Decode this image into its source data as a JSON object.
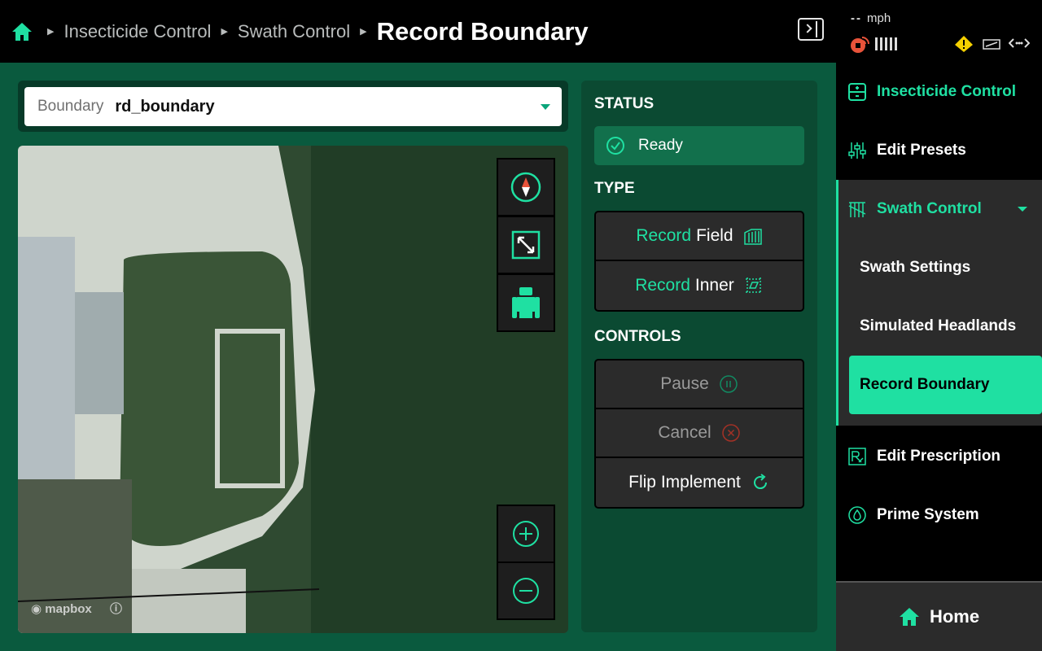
{
  "breadcrumb": {
    "items": [
      "Insecticide Control",
      "Swath Control"
    ],
    "current": "Record Boundary"
  },
  "status_bar": {
    "speed_value": "--",
    "speed_unit": "mph"
  },
  "boundary_select": {
    "label": "Boundary",
    "value": "rd_boundary"
  },
  "map": {
    "attribution": "mapbox"
  },
  "panel": {
    "status_title": "STATUS",
    "status_value": "Ready",
    "type_title": "TYPE",
    "record_field": {
      "prefix": "Record",
      "suffix": "Field"
    },
    "record_inner": {
      "prefix": "Record",
      "suffix": "Inner"
    },
    "controls_title": "CONTROLS",
    "pause_label": "Pause",
    "cancel_label": "Cancel",
    "flip_label": "Flip Implement"
  },
  "nav": {
    "items": [
      {
        "label": "Insecticide Control"
      },
      {
        "label": "Edit Presets"
      },
      {
        "label": "Swath Control"
      },
      {
        "label": "Edit Prescription"
      },
      {
        "label": "Prime System"
      }
    ],
    "sub_items": [
      {
        "label": "Swath Settings"
      },
      {
        "label": "Simulated Headlands"
      },
      {
        "label": "Record Boundary"
      }
    ],
    "home_label": "Home"
  },
  "colors": {
    "accent": "#1fe0a2",
    "main_bg": "#0a5a3e",
    "panel_bg": "#0b4a32"
  }
}
